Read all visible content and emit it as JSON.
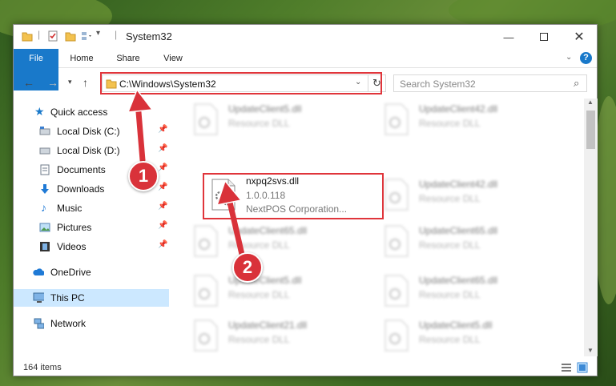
{
  "window": {
    "title": "System32"
  },
  "ribbon": {
    "tabs": [
      {
        "label": "File"
      },
      {
        "label": "Home"
      },
      {
        "label": "Share"
      },
      {
        "label": "View"
      }
    ]
  },
  "address": {
    "path": "C:\\Windows\\System32"
  },
  "search": {
    "placeholder": "Search System32"
  },
  "sidebar": {
    "quick_access": "Quick access",
    "items": [
      {
        "label": "Local Disk (C:)"
      },
      {
        "label": "Local Disk (D:)"
      },
      {
        "label": "Documents"
      },
      {
        "label": "Downloads"
      },
      {
        "label": "Music"
      },
      {
        "label": "Pictures"
      },
      {
        "label": "Videos"
      }
    ],
    "onedrive": "OneDrive",
    "this_pc": "This PC",
    "network": "Network"
  },
  "files": [
    {
      "name": "UpdateClient5.dll",
      "type": "Resource DLL"
    },
    {
      "name": "UpdateClient42.dll",
      "type": "Resource DLL"
    },
    {
      "name": "nxpq2svs.dll",
      "version": "1.0.0.118",
      "company": "NextPOS Corporation..."
    },
    {
      "name": "UpdateClient42.dll",
      "type": "Resource DLL"
    },
    {
      "name": "UpdateClient65.dll",
      "type": "Resource DLL"
    },
    {
      "name": "UpdateClient65.dll",
      "type": "Resource DLL"
    },
    {
      "name": "UpdateClient5.dll",
      "type": "Resource DLL"
    },
    {
      "name": "UpdateClient65.dll",
      "type": "Resource DLL"
    },
    {
      "name": "UpdateClient21.dll",
      "type": "Resource DLL"
    },
    {
      "name": "UpdateClient5.dll",
      "type": "Resource DLL"
    }
  ],
  "status": {
    "item_count": "164 items"
  },
  "callouts": {
    "one": "1",
    "two": "2"
  },
  "colors": {
    "accent": "#1979ca",
    "highlight": "#e0353b",
    "selected": "#cce8ff"
  }
}
